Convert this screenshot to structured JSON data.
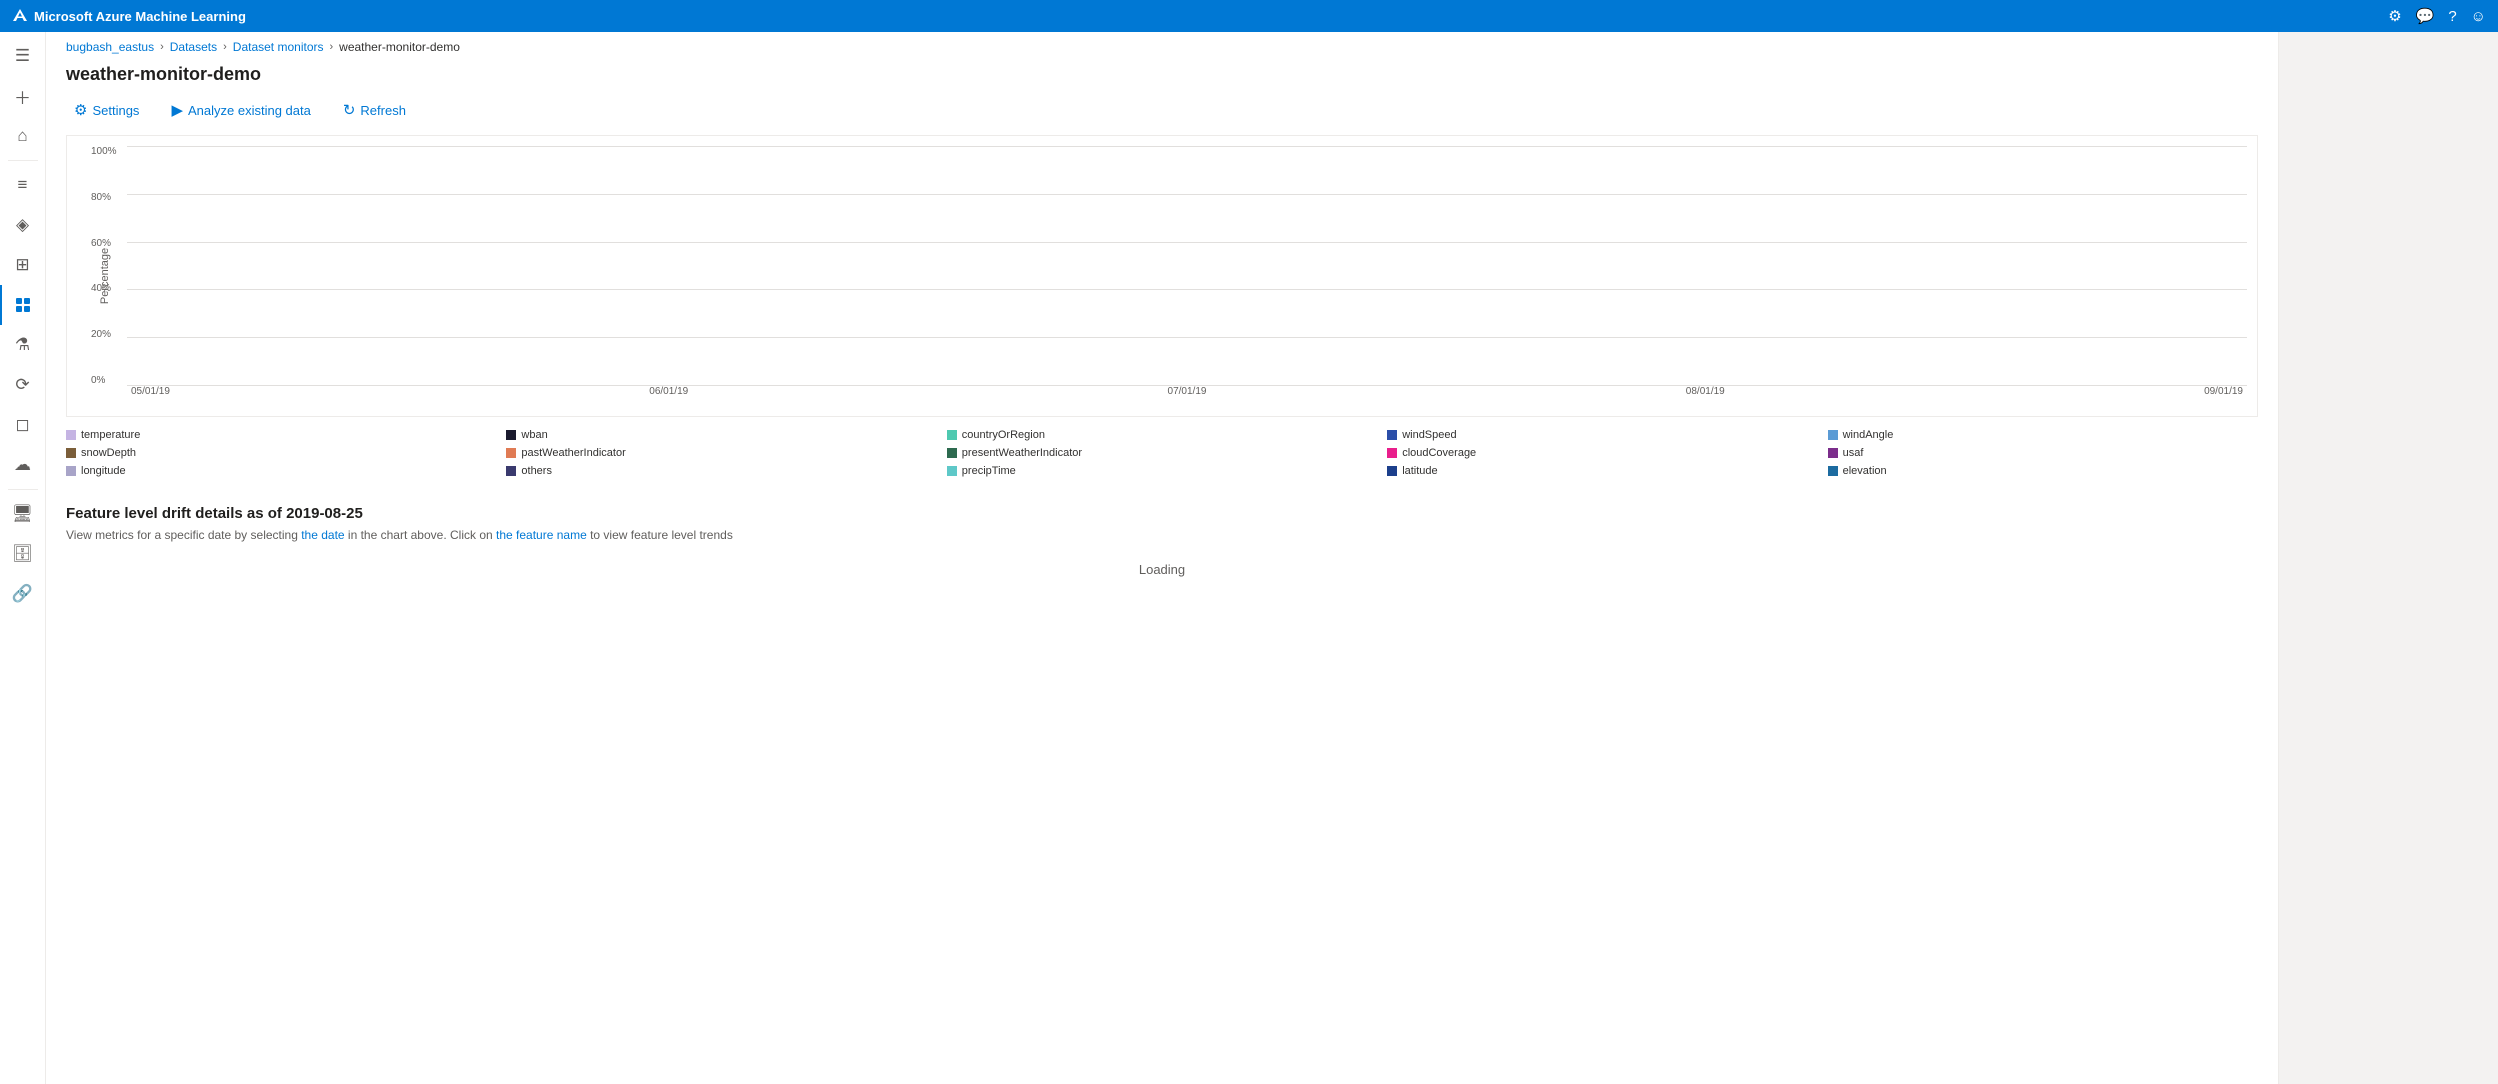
{
  "topbar": {
    "title": "Microsoft Azure Machine Learning",
    "icons": [
      "settings",
      "feedback",
      "help",
      "user"
    ]
  },
  "breadcrumb": {
    "items": [
      "bugbash_eastus",
      "Datasets",
      "Dataset monitors"
    ],
    "current": "weather-monitor-demo"
  },
  "page": {
    "title": "weather-monitor-demo"
  },
  "toolbar": {
    "settings_label": "Settings",
    "analyze_label": "Analyze existing data",
    "refresh_label": "Refresh"
  },
  "chart": {
    "y_axis_label": "Percentage",
    "y_ticks": [
      "100%",
      "80%",
      "60%",
      "40%",
      "20%",
      "0%"
    ],
    "x_labels": [
      "05/01/19",
      "06/01/19",
      "07/01/19",
      "08/01/19",
      "09/01/19"
    ]
  },
  "legend": {
    "items": [
      {
        "label": "temperature",
        "color": "#c5b4e3"
      },
      {
        "label": "wban",
        "color": "#1a1a2e"
      },
      {
        "label": "countryOrRegion",
        "color": "#4ec9b0"
      },
      {
        "label": "windSpeed",
        "color": "#2b4ea8"
      },
      {
        "label": "windAngle",
        "color": "#5b9bd5"
      },
      {
        "label": "snowDepth",
        "color": "#7b5e3a"
      },
      {
        "label": "pastWeatherIndicator",
        "color": "#e07b54"
      },
      {
        "label": "presentWeatherIndicator",
        "color": "#2d6a4f"
      },
      {
        "label": "cloudCoverage",
        "color": "#e91e8c"
      },
      {
        "label": "usaf",
        "color": "#7b2d8b"
      },
      {
        "label": "longitude",
        "color": "#a8a4c8"
      },
      {
        "label": "others",
        "color": "#3a3a6e"
      },
      {
        "label": "precipTime",
        "color": "#5ec8c8"
      },
      {
        "label": "latitude",
        "color": "#1c3f8c"
      },
      {
        "label": "elevation",
        "color": "#1c6ba0"
      }
    ]
  },
  "feature_section": {
    "title": "Feature level drift details as of 2019-08-25",
    "subtitle_text": "View metrics for a specific date by selecting the date in the chart above. Click on the feature name to view feature level trends",
    "loading": "Loading"
  }
}
